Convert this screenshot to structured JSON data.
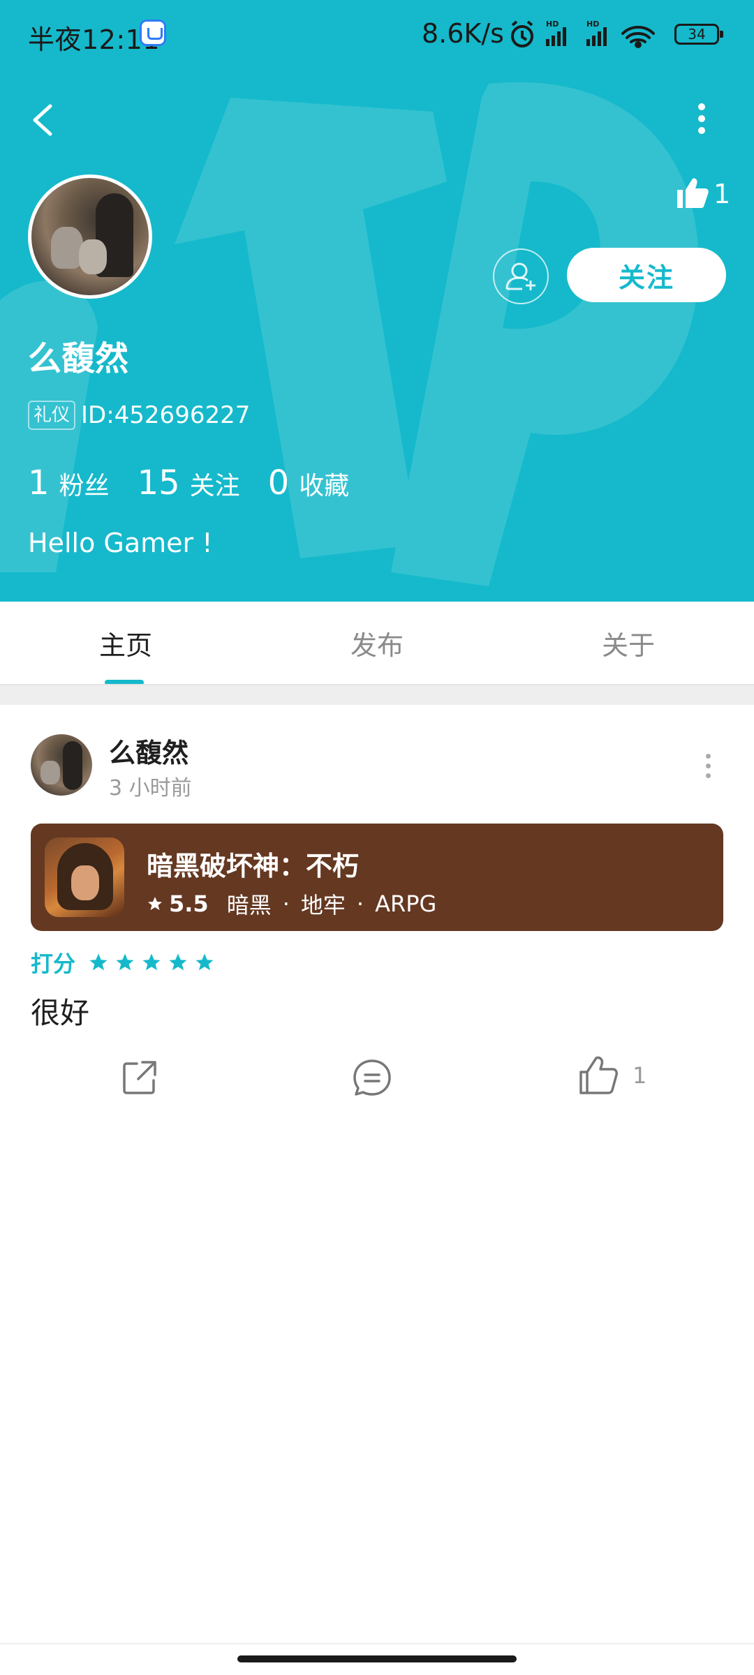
{
  "status_bar": {
    "time": "半夜12:11",
    "network_speed": "8.6K/s",
    "battery": "34"
  },
  "profile": {
    "like_count": "1",
    "follow_label": "关注",
    "username": "么馥然",
    "badge": "礼仪",
    "user_id": "ID:452696227",
    "stats": [
      {
        "value": "1",
        "label": "粉丝"
      },
      {
        "value": "15",
        "label": "关注"
      },
      {
        "value": "0",
        "label": "收藏"
      }
    ],
    "bio": "Hello Gamer !"
  },
  "tabs": [
    {
      "label": "主页",
      "active": true
    },
    {
      "label": "发布",
      "active": false
    },
    {
      "label": "关于",
      "active": false
    }
  ],
  "post": {
    "author": "么馥然",
    "time": "3 小时前",
    "game": {
      "title": "暗黑破坏神：不朽",
      "rating": "5.5",
      "tags": [
        "暗黑",
        "地牢",
        "ARPG"
      ],
      "card_color": "#653821"
    },
    "rating_label": "打分",
    "stars": 5,
    "content": "很好",
    "like_count": "1"
  },
  "colors": {
    "accent": "#15b9cb"
  }
}
